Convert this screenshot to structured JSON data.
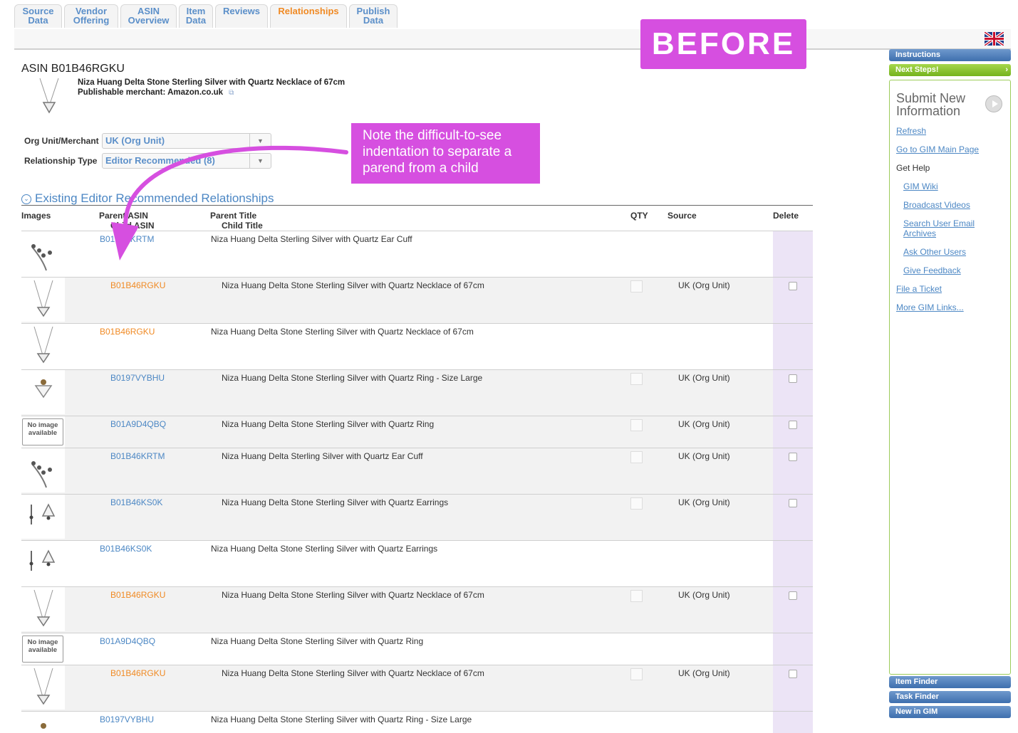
{
  "tabs": [
    {
      "l1": "Source",
      "l2": "Data"
    },
    {
      "l1": "Vendor",
      "l2": "Offering"
    },
    {
      "l1": "ASIN",
      "l2": "Overview"
    },
    {
      "l1": "Item",
      "l2": "Data"
    },
    {
      "l1": "Reviews",
      "l2": ""
    },
    {
      "l1": "Relationships",
      "l2": ""
    },
    {
      "l1": "Publish",
      "l2": "Data"
    }
  ],
  "header": {
    "asin_title": "ASIN B01B46RGKU",
    "product_name": "Niza Huang Delta Stone Sterling Silver with Quartz Necklace of 67cm",
    "merchant": "Publishable merchant: Amazon.co.uk"
  },
  "form": {
    "org_label": "Org Unit/Merchant",
    "org_value": "UK (Org Unit)",
    "rel_label": "Relationship Type",
    "rel_value": "Editor Recommended (8)"
  },
  "section": {
    "title": "Existing Editor Recommended Relationships"
  },
  "columns": {
    "images": "Images",
    "parent_asin": "Parent ASIN",
    "child_asin": "Child ASIN",
    "parent_title": "Parent Title",
    "child_title": "Child Title",
    "qty": "QTY",
    "source": "Source",
    "delete": "Delete"
  },
  "rows": [
    {
      "asin": "B01B46KRTM",
      "title": "Niza Huang Delta Sterling Silver with Quartz Ear Cuff",
      "source": ""
    },
    {
      "asin": "B01B46RGKU",
      "title": "Niza Huang Delta Stone Sterling Silver with Quartz Necklace of 67cm",
      "source": "UK (Org Unit)"
    },
    {
      "asin": "B01B46RGKU",
      "title": "Niza Huang Delta Stone Sterling Silver with Quartz Necklace of 67cm",
      "source": ""
    },
    {
      "asin": "B0197VYBHU",
      "title": "Niza Huang Delta Stone Sterling Silver with Quartz Ring - Size Large",
      "source": "UK (Org Unit)"
    },
    {
      "asin": "B01A9D4QBQ",
      "title": "Niza Huang Delta Stone Sterling Silver with Quartz Ring",
      "source": "UK (Org Unit)",
      "noimg": "No image available"
    },
    {
      "asin": "B01B46KRTM",
      "title": "Niza Huang Delta Sterling Silver with Quartz Ear Cuff",
      "source": "UK (Org Unit)"
    },
    {
      "asin": "B01B46KS0K",
      "title": "Niza Huang Delta Stone Sterling Silver with Quartz Earrings",
      "source": "UK (Org Unit)"
    },
    {
      "asin": "B01B46KS0K",
      "title": "Niza Huang Delta Stone Sterling Silver with Quartz Earrings",
      "source": ""
    },
    {
      "asin": "B01B46RGKU",
      "title": "Niza Huang Delta Stone Sterling Silver with Quartz Necklace of 67cm",
      "source": "UK (Org Unit)"
    },
    {
      "asin": "B01A9D4QBQ",
      "title": "Niza Huang Delta Stone Sterling Silver with Quartz Ring",
      "source": "",
      "noimg": "No image available"
    },
    {
      "asin": "B01B46RGKU",
      "title": "Niza Huang Delta Stone Sterling Silver with Quartz Necklace of 67cm",
      "source": "UK (Org Unit)"
    },
    {
      "asin": "B0197VYBHU",
      "title": "Niza Huang Delta Stone Sterling Silver with Quartz Ring - Size Large",
      "source": ""
    }
  ],
  "sidebar": {
    "instructions": "Instructions",
    "next_steps": "Next Steps!",
    "submit_title": "Submit New Information",
    "refresh": "Refresh",
    "gim_main": "Go to GIM Main Page",
    "get_help": "Get Help",
    "gim_wiki": "GIM Wiki",
    "broadcast": "Broadcast Videos",
    "search_email_1": "Search User Email",
    "search_email_2": "Archives",
    "ask_users": "Ask Other Users",
    "feedback": "Give Feedback",
    "file_ticket": "File a Ticket",
    "more_links": "More GIM Links...",
    "item_finder": "Item Finder",
    "task_finder": "Task Finder",
    "new_in_gim": "New in GIM"
  },
  "annotations": {
    "before": "BEFORE",
    "note_l1": "Note the difficult-to-see",
    "note_l2": "indentation to separate a",
    "note_l3": "parend  from a child"
  },
  "colors": {
    "link_blue": "#4c87c4",
    "active_orange": "#f08a24",
    "annotation_magenta": "#d64fe0",
    "delete_column": "#ece4f6",
    "sidebar_green": "#9ccc5a"
  }
}
